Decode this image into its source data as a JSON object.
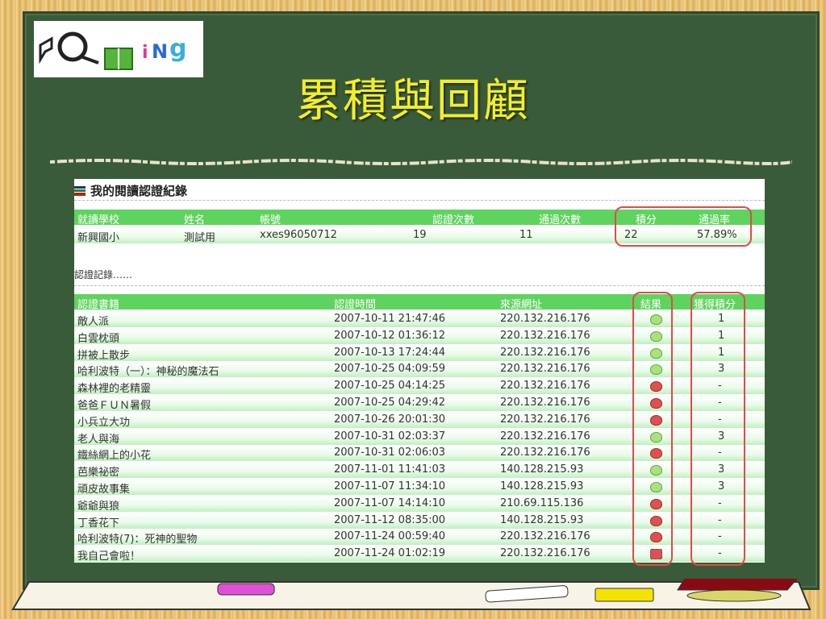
{
  "title": "累積與回顧",
  "logo_text": "GO ing",
  "panel": {
    "heading": "我的閱讀認證紀錄",
    "summary_headers": [
      "就讀學校",
      "姓名",
      "帳號",
      "認證次數",
      "通過次數",
      "積分",
      "通過率"
    ],
    "summary_values": [
      "新興國小",
      "測試用",
      "xxes96050712",
      "19",
      "11",
      "22",
      "57.89%"
    ],
    "records_label": "認證記錄……",
    "record_headers": [
      "認證書籍",
      "認證時間",
      "來源網址",
      "結果",
      "獲得積分"
    ],
    "records": [
      {
        "book": "敵人派",
        "time": "2007-10-11 21:47:46",
        "ip": "220.132.216.176",
        "result": "pass",
        "score": "1"
      },
      {
        "book": "白雲枕頭",
        "time": "2007-10-12 01:36:12",
        "ip": "220.132.216.176",
        "result": "pass",
        "score": "1"
      },
      {
        "book": "拼被上散步",
        "time": "2007-10-13 17:24:44",
        "ip": "220.132.216.176",
        "result": "pass",
        "score": "1"
      },
      {
        "book": "哈利波特（一）：神秘的魔法石",
        "time": "2007-10-25 04:09:59",
        "ip": "220.132.216.176",
        "result": "pass",
        "score": "3"
      },
      {
        "book": "森林裡的老精靈",
        "time": "2007-10-25 04:14:25",
        "ip": "220.132.216.176",
        "result": "fail",
        "score": "-"
      },
      {
        "book": "爸爸ＦＵＮ暑假",
        "time": "2007-10-25 04:29:42",
        "ip": "220.132.216.176",
        "result": "fail",
        "score": "-"
      },
      {
        "book": "小兵立大功",
        "time": "2007-10-26 20:01:30",
        "ip": "220.132.216.176",
        "result": "fail",
        "score": "-"
      },
      {
        "book": "老人與海",
        "time": "2007-10-31 02:03:37",
        "ip": "220.132.216.176",
        "result": "pass",
        "score": "3"
      },
      {
        "book": "鐵絲網上的小花",
        "time": "2007-10-31 02:06:03",
        "ip": "220.132.216.176",
        "result": "fail",
        "score": "-"
      },
      {
        "book": "芭樂祕密",
        "time": "2007-11-01 11:41:03",
        "ip": "140.128.215.93",
        "result": "pass",
        "score": "3"
      },
      {
        "book": "頑皮故事集",
        "time": "2007-11-07 11:34:10",
        "ip": "140.128.215.93",
        "result": "pass",
        "score": "3"
      },
      {
        "book": "爺爺與狼",
        "time": "2007-11-07 14:14:10",
        "ip": "210.69.115.136",
        "result": "fail",
        "score": "-"
      },
      {
        "book": "丁香花下",
        "time": "2007-11-12 08:35:00",
        "ip": "140.128.215.93",
        "result": "fail",
        "score": "-"
      },
      {
        "book": "哈利波特(7)：死神的聖物",
        "time": "2007-11-24 00:59:40",
        "ip": "220.132.216.176",
        "result": "fail",
        "score": "-"
      },
      {
        "book": "我自己會啦！",
        "time": "2007-11-24 01:02:19",
        "ip": "220.132.216.176",
        "result": "selected",
        "score": "-"
      }
    ]
  }
}
